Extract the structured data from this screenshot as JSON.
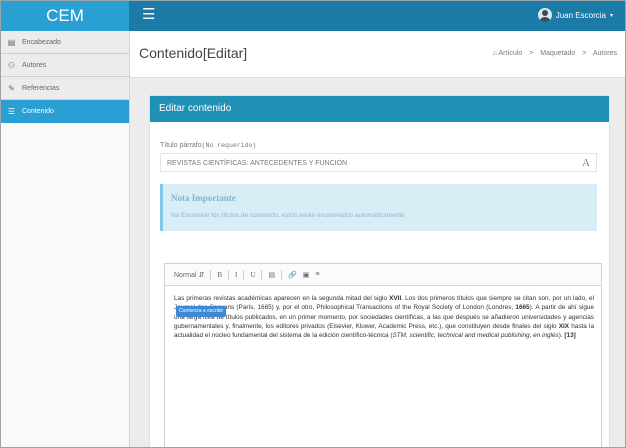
{
  "app": {
    "brand": "CEM",
    "menu_icon": "hamburger-icon"
  },
  "user": {
    "name": "Juan Escorcia",
    "caret": "▾"
  },
  "sidebar": {
    "items": [
      {
        "label": "Encabezado",
        "icon": "header-icon",
        "glyph": "▤"
      },
      {
        "label": "Autores",
        "icon": "users-icon",
        "glyph": "👥"
      },
      {
        "label": "Referencias",
        "icon": "edit-icon",
        "glyph": "✎"
      },
      {
        "label": "Contenido",
        "icon": "list-icon",
        "glyph": "☰",
        "active": true
      }
    ]
  },
  "header": {
    "title": "Contenido[Editar]",
    "breadcrumb": [
      "Artículo",
      "Maquetado",
      "Autores"
    ]
  },
  "card": {
    "title": "Editar contenido",
    "field_label": "Título párrafo",
    "field_hint": "(No requerido)",
    "title_value": "REVISTAS CIENTÍFICAS: ANTECEDENTES Y FUNCIÓN",
    "font_icon": "A",
    "alert_title": "Nota Importante",
    "alert_text": "No Enumerar los títulos de contenido, estos serán enumerados automáticamente"
  },
  "editor": {
    "toolbar": {
      "format": "Normal",
      "bold": "B",
      "italic": "I",
      "underline": "U"
    },
    "tooltip": "Comienza a escribir",
    "p1": "Las primeras revistas académicas aparecen en la segunda mitad del siglo ",
    "b1": "XVII",
    "p2": ". Los dos primeros títulos que siempre se citan son, por un lado, el Journal des Sçavans (París, 1665) y, por el otro, Philosophical Transactions of the Royal Society of London (Londres, ",
    "b2": "1665",
    "p3": "). A partir de ahí sigue una larga lista de títulos publicados, en un primer momento, por sociedades científicas, a las que después se añadieron universidades y agencias gubernamentales y, finalmente, los editores privados (Elsevier, Kluwer, Academic Press, etc.), que constituyen desde finales del siglo ",
    "b3": "XIX",
    "p4": " hasta la actualidad el núcleo fundamental del sistema de la edición científico-técnica (",
    "i1": "STM, scientific, technical and medical publishing, en inglés",
    "p5": "). ",
    "b4": "[13]"
  }
}
